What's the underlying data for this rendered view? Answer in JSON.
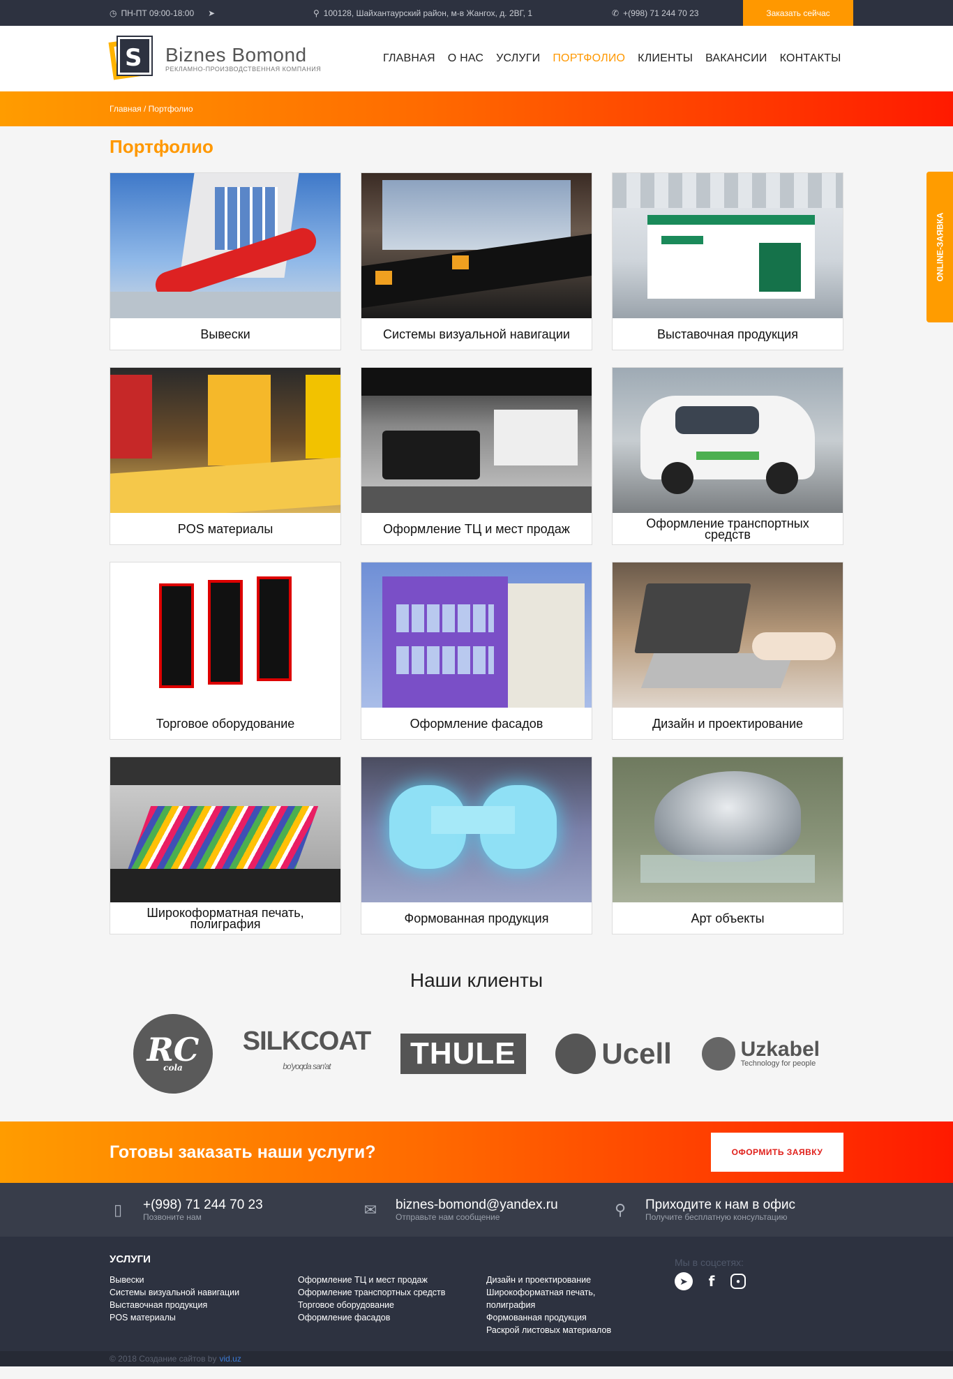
{
  "topbar": {
    "hours": "ПН-ПТ 09:00-18:00",
    "address": "100128, Шайхантаурский район, м-в Жангох, д. 2ВГ, 1",
    "phone": "+(998) 71 244 70 23",
    "order_button": "Заказать сейчас"
  },
  "logo": {
    "name": "Biznes Bomond",
    "tagline": "РЕКЛАМНО-ПРОИЗВОДСТВЕННАЯ КОМПАНИЯ"
  },
  "nav": [
    {
      "label": "ГЛАВНАЯ"
    },
    {
      "label": "О НАС"
    },
    {
      "label": "УСЛУГИ"
    },
    {
      "label": "ПОРТФОЛИО"
    },
    {
      "label": "КЛИЕНТЫ"
    },
    {
      "label": "ВАКАНСИИ"
    },
    {
      "label": "КОНТАКТЫ"
    }
  ],
  "nav_active": "ПОРТФОЛИО",
  "breadcrumb": "Главная / Портфолио",
  "page_title": "Портфолио",
  "portfolio": [
    {
      "caption": "Вывески"
    },
    {
      "caption": "Системы визуальной навигации"
    },
    {
      "caption": "Выставочная продукция"
    },
    {
      "caption": "POS материалы"
    },
    {
      "caption": "Оформление ТЦ и мест продаж"
    },
    {
      "caption": "Оформление транспортных средств"
    },
    {
      "caption": "Торговое оборудование"
    },
    {
      "caption": "Оформление фасадов"
    },
    {
      "caption": "Дизайн и проектирование"
    },
    {
      "caption": "Широкоформатная печать, полиграфия"
    },
    {
      "caption": "Формованная продукция"
    },
    {
      "caption": "Арт объекты"
    }
  ],
  "clients": {
    "title": "Наши клиенты",
    "logos": {
      "rc_main": "RC",
      "rc_sub": "cola",
      "silkcoat_main": "SILKCOAT",
      "silkcoat_sub": "bo'yoqda san'at",
      "thule": "THULE",
      "ucell": "Ucell",
      "uzkabel_main": "Uzkabel",
      "uzkabel_sub": "Technology for people"
    }
  },
  "cta": {
    "text": "Готовы заказать наши услуги?",
    "button": "ОФОРМИТЬ ЗАЯВКУ"
  },
  "contacts": {
    "phone": "+(998) 71 244 70 23",
    "phone_sub": "Позвоните нам",
    "email": "biznes-bomond@yandex.ru",
    "email_sub": "Отправьте нам сообщение",
    "office": "Приходите к нам в офис",
    "office_sub": "Получите бесплатную консультацию"
  },
  "footer": {
    "title": "УСЛУГИ",
    "col1": [
      "Вывески",
      "Системы визуальной навигации",
      "Выставочная продукция",
      "POS материалы"
    ],
    "col2": [
      "Оформление ТЦ и мест продаж",
      "Оформление транспортных средств",
      "Торговое оборудование",
      "Оформление фасадов"
    ],
    "col3": [
      "Дизайн и проектирование",
      "Широкоформатная печать, полиграфия",
      "Формованная продукция",
      "Раскрой листовых материалов"
    ],
    "social_label": "Мы в соцсетях:",
    "copyright": "© 2018 Создание сайтов by",
    "copyright_link": "vid.uz"
  },
  "side_tab": "ONLINE-ЗАЯВКА",
  "colors": {
    "accent": "#ff9800",
    "dark": "#2d3240",
    "red": "#ff1a00"
  }
}
